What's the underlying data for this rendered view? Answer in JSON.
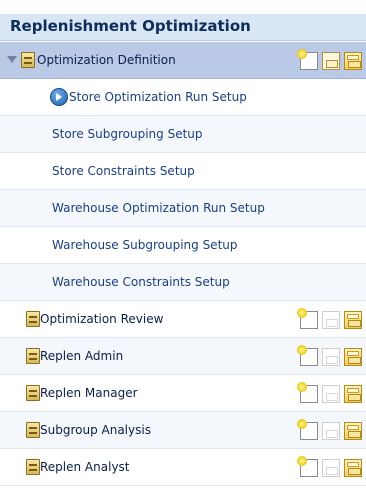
{
  "panel": {
    "title": "Replenishment Optimization"
  },
  "tree": {
    "expanded_group": {
      "label": "Optimization Definition",
      "children": [
        {
          "label": "Store Optimization Run Setup"
        },
        {
          "label": "Store Subgrouping Setup"
        },
        {
          "label": "Store Constraints Setup"
        },
        {
          "label": "Warehouse Optimization Run Setup"
        },
        {
          "label": "Warehouse Subgrouping Setup"
        },
        {
          "label": "Warehouse Constraints Setup"
        }
      ]
    },
    "collapsed_groups": [
      {
        "label": "Optimization Review"
      },
      {
        "label": "Replen Admin"
      },
      {
        "label": "Replen Manager"
      },
      {
        "label": "Subgroup Analysis"
      },
      {
        "label": "Replen Analyst"
      }
    ]
  },
  "icons": {
    "cabinet": "workbook-cabinet-icon",
    "run": "run-arrow-icon",
    "new": "new-workbook-icon",
    "open": "open-workbook-icon",
    "folder": "folder-icon"
  },
  "colors": {
    "header_bg": "#d9e6f3",
    "selected_row_bg": "#b9c9e6",
    "link_text": "#1a3f8a"
  }
}
